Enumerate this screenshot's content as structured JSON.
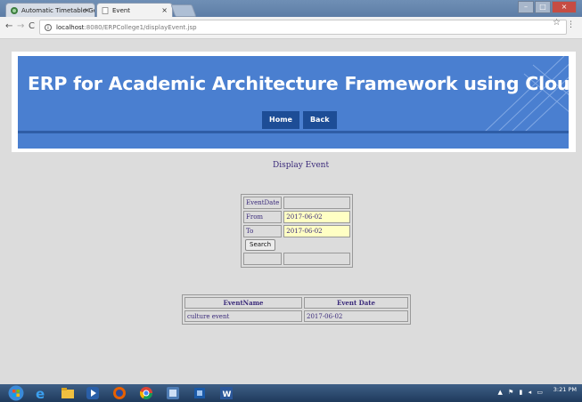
{
  "browser": {
    "tabs": [
      {
        "label": "Automatic Timetable Ge",
        "active": false
      },
      {
        "label": "Event",
        "active": true
      }
    ],
    "url_host": "localhost",
    "url_path": ":8080/ERPCollege1/displayEvent.jsp"
  },
  "header": {
    "title": "ERP for Academic Architecture Framework using Cloud Computing",
    "nav": [
      "Home",
      "Back"
    ]
  },
  "main": {
    "heading": "Display Event",
    "form": {
      "header_label": "EventDate",
      "from_label": "From",
      "from_value": "2017-06-02",
      "to_label": "To",
      "to_value": "2017-06-02",
      "search_label": "Search"
    },
    "results": {
      "columns": [
        "EventName",
        "Event Date"
      ],
      "rows": [
        [
          "culture event",
          "2017-06-02"
        ]
      ]
    }
  },
  "taskbar": {
    "time": "3:21 PM"
  },
  "colors": {
    "banner": "#4a7fd0",
    "nav_button": "#1d4d96",
    "date_field": "#ffffc4"
  }
}
